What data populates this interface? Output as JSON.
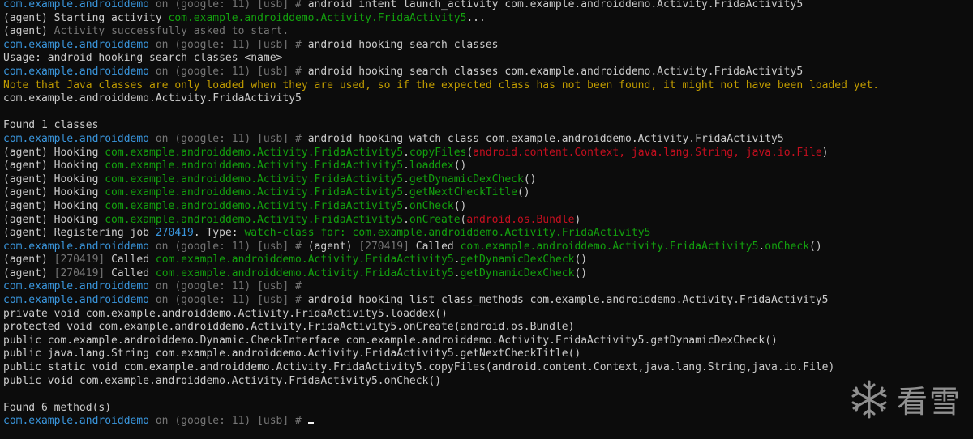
{
  "colors": {
    "background": "#0c0c0c",
    "default": "#cccccc",
    "blue": "#3a96dd",
    "dim": "#767676",
    "green": "#13a10e",
    "red": "#c50f1f",
    "yellow": "#c19c00"
  },
  "prompt": {
    "app": "com.example.androiddemo",
    "device": " on (google: 11) [usb] # "
  },
  "lines": [
    [
      {
        "t": "com.example.androiddemo",
        "c": "blue"
      },
      {
        "t": " on (google: 11) [usb] # ",
        "c": "dim"
      },
      {
        "t": "android intent launch_activity com.example.androiddemo.Activity.FridaActivity5",
        "c": "white"
      }
    ],
    [
      {
        "t": "(agent) Starting activity ",
        "c": "white"
      },
      {
        "t": "com.example.androiddemo.Activity.FridaActivity5",
        "c": "green"
      },
      {
        "t": "...",
        "c": "white"
      }
    ],
    [
      {
        "t": "(agent) ",
        "c": "white"
      },
      {
        "t": "Activity successfully asked to start.",
        "c": "dim"
      }
    ],
    [
      {
        "t": "com.example.androiddemo",
        "c": "blue"
      },
      {
        "t": " on (google: 11) [usb] # ",
        "c": "dim"
      },
      {
        "t": "android hooking search classes",
        "c": "white"
      }
    ],
    [
      {
        "t": "Usage: android hooking search classes <name>",
        "c": "white"
      }
    ],
    [
      {
        "t": "com.example.androiddemo",
        "c": "blue"
      },
      {
        "t": " on (google: 11) [usb] # ",
        "c": "dim"
      },
      {
        "t": "android hooking search classes com.example.androiddemo.Activity.FridaActivity5",
        "c": "white"
      }
    ],
    [
      {
        "t": "Note that Java classes are only loaded when they are used, so if the expected class has not been found, it might not have been loaded yet.",
        "c": "yellow"
      }
    ],
    [
      {
        "t": "com.example.androiddemo.Activity.FridaActivity5",
        "c": "white"
      }
    ],
    [
      {
        "t": "",
        "c": "white"
      }
    ],
    [
      {
        "t": "Found 1 classes",
        "c": "white"
      }
    ],
    [
      {
        "t": "com.example.androiddemo",
        "c": "blue"
      },
      {
        "t": " on (google: 11) [usb] # ",
        "c": "dim"
      },
      {
        "t": "android hooking watch class com.example.androiddemo.Activity.FridaActivity5",
        "c": "white"
      }
    ],
    [
      {
        "t": "(agent) Hooking ",
        "c": "white"
      },
      {
        "t": "com.example.androiddemo.Activity.FridaActivity5",
        "c": "green"
      },
      {
        "t": ".",
        "c": "white"
      },
      {
        "t": "copyFiles",
        "c": "green"
      },
      {
        "t": "(",
        "c": "white"
      },
      {
        "t": "android.content.Context, java.lang.String, java.io.File",
        "c": "red"
      },
      {
        "t": ")",
        "c": "white"
      }
    ],
    [
      {
        "t": "(agent) Hooking ",
        "c": "white"
      },
      {
        "t": "com.example.androiddemo.Activity.FridaActivity5",
        "c": "green"
      },
      {
        "t": ".",
        "c": "white"
      },
      {
        "t": "loaddex",
        "c": "green"
      },
      {
        "t": "()",
        "c": "white"
      }
    ],
    [
      {
        "t": "(agent) Hooking ",
        "c": "white"
      },
      {
        "t": "com.example.androiddemo.Activity.FridaActivity5",
        "c": "green"
      },
      {
        "t": ".",
        "c": "white"
      },
      {
        "t": "getDynamicDexCheck",
        "c": "green"
      },
      {
        "t": "()",
        "c": "white"
      }
    ],
    [
      {
        "t": "(agent) Hooking ",
        "c": "white"
      },
      {
        "t": "com.example.androiddemo.Activity.FridaActivity5",
        "c": "green"
      },
      {
        "t": ".",
        "c": "white"
      },
      {
        "t": "getNextCheckTitle",
        "c": "green"
      },
      {
        "t": "()",
        "c": "white"
      }
    ],
    [
      {
        "t": "(agent) Hooking ",
        "c": "white"
      },
      {
        "t": "com.example.androiddemo.Activity.FridaActivity5",
        "c": "green"
      },
      {
        "t": ".",
        "c": "white"
      },
      {
        "t": "onCheck",
        "c": "green"
      },
      {
        "t": "()",
        "c": "white"
      }
    ],
    [
      {
        "t": "(agent) Hooking ",
        "c": "white"
      },
      {
        "t": "com.example.androiddemo.Activity.FridaActivity5",
        "c": "green"
      },
      {
        "t": ".",
        "c": "white"
      },
      {
        "t": "onCreate",
        "c": "green"
      },
      {
        "t": "(",
        "c": "white"
      },
      {
        "t": "android.os.Bundle",
        "c": "red"
      },
      {
        "t": ")",
        "c": "white"
      }
    ],
    [
      {
        "t": "(agent) Registering job ",
        "c": "white"
      },
      {
        "t": "270419",
        "c": "blue"
      },
      {
        "t": ". Type: ",
        "c": "white"
      },
      {
        "t": "watch-class for: com.example.androiddemo.Activity.FridaActivity5",
        "c": "green"
      }
    ],
    [
      {
        "t": "com.example.androiddemo",
        "c": "blue"
      },
      {
        "t": " on (google: 11) [usb] # ",
        "c": "dim"
      },
      {
        "t": "(agent) ",
        "c": "white"
      },
      {
        "t": "[270419]",
        "c": "dim"
      },
      {
        "t": " Called ",
        "c": "white"
      },
      {
        "t": "com.example.androiddemo.Activity.FridaActivity5",
        "c": "green"
      },
      {
        "t": ".",
        "c": "white"
      },
      {
        "t": "onCheck",
        "c": "green"
      },
      {
        "t": "()",
        "c": "white"
      }
    ],
    [
      {
        "t": "(agent) ",
        "c": "white"
      },
      {
        "t": "[270419]",
        "c": "dim"
      },
      {
        "t": " Called ",
        "c": "white"
      },
      {
        "t": "com.example.androiddemo.Activity.FridaActivity5",
        "c": "green"
      },
      {
        "t": ".",
        "c": "white"
      },
      {
        "t": "getDynamicDexCheck",
        "c": "green"
      },
      {
        "t": "()",
        "c": "white"
      }
    ],
    [
      {
        "t": "(agent) ",
        "c": "white"
      },
      {
        "t": "[270419]",
        "c": "dim"
      },
      {
        "t": " Called ",
        "c": "white"
      },
      {
        "t": "com.example.androiddemo.Activity.FridaActivity5",
        "c": "green"
      },
      {
        "t": ".",
        "c": "white"
      },
      {
        "t": "getDynamicDexCheck",
        "c": "green"
      },
      {
        "t": "()",
        "c": "white"
      }
    ],
    [
      {
        "t": "com.example.androiddemo",
        "c": "blue"
      },
      {
        "t": " on (google: 11) [usb] #",
        "c": "dim"
      }
    ],
    [
      {
        "t": "com.example.androiddemo",
        "c": "blue"
      },
      {
        "t": " on (google: 11) [usb] # ",
        "c": "dim"
      },
      {
        "t": "android hooking list class_methods com.example.androiddemo.Activity.FridaActivity5",
        "c": "white"
      }
    ],
    [
      {
        "t": "private void com.example.androiddemo.Activity.FridaActivity5.loaddex()",
        "c": "white"
      }
    ],
    [
      {
        "t": "protected void com.example.androiddemo.Activity.FridaActivity5.onCreate(android.os.Bundle)",
        "c": "white"
      }
    ],
    [
      {
        "t": "public com.example.androiddemo.Dynamic.CheckInterface com.example.androiddemo.Activity.FridaActivity5.getDynamicDexCheck()",
        "c": "white"
      }
    ],
    [
      {
        "t": "public java.lang.String com.example.androiddemo.Activity.FridaActivity5.getNextCheckTitle()",
        "c": "white"
      }
    ],
    [
      {
        "t": "public static void com.example.androiddemo.Activity.FridaActivity5.copyFiles(android.content.Context,java.lang.String,java.io.File)",
        "c": "white"
      }
    ],
    [
      {
        "t": "public void com.example.androiddemo.Activity.FridaActivity5.onCheck()",
        "c": "white"
      }
    ],
    [
      {
        "t": "",
        "c": "white"
      }
    ],
    [
      {
        "t": "Found 6 method(s)",
        "c": "white"
      }
    ],
    [
      {
        "t": "com.example.androiddemo",
        "c": "blue"
      },
      {
        "t": " on (google: 11) [usb] # ",
        "c": "dim"
      }
    ]
  ],
  "watermark": {
    "text": "看雪",
    "icon": "snowflake-icon"
  }
}
